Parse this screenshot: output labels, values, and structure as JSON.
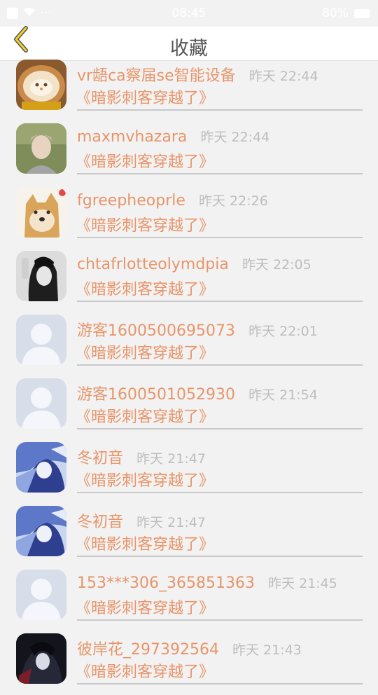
{
  "status_bar": {
    "time": "08:45",
    "battery": "80%",
    "signal": "···"
  },
  "header": {
    "title": "收藏"
  },
  "items": [
    {
      "name": "vr龉ca察届se智能设备",
      "time": "昨天 22:44",
      "game": "《暗影刺客穿越了》",
      "avatar": "latte-art-avatar"
    },
    {
      "name": "maxmvhazara",
      "time": "昨天 22:44",
      "game": "《暗影刺客穿越了》",
      "avatar": "photo-avatar-green"
    },
    {
      "name": "fgreepheoprle",
      "time": "昨天 22:26",
      "game": "《暗影刺客穿越了》",
      "avatar": "doge-avatar"
    },
    {
      "name": "chtafrlotteolymdpia",
      "time": "昨天 22:05",
      "game": "《暗影刺客穿越了》",
      "avatar": "photo-avatar-bw"
    },
    {
      "name": "游客1600500695073",
      "time": "昨天 22:01",
      "game": "《暗影刺客穿越了》",
      "avatar": "default-user-avatar"
    },
    {
      "name": "游客1600501052930",
      "time": "昨天 21:54",
      "game": "《暗影刺客穿越了》",
      "avatar": "default-user-avatar"
    },
    {
      "name": "冬初音",
      "time": "昨天 21:47",
      "game": "《暗影刺客穿越了》",
      "avatar": "anime-avatar"
    },
    {
      "name": "冬初音",
      "time": "昨天 21:47",
      "game": "《暗影刺客穿越了》",
      "avatar": "anime-avatar"
    },
    {
      "name": "153***306_365851363",
      "time": "昨天 21:45",
      "game": "《暗影刺客穿越了》",
      "avatar": "default-user-avatar"
    },
    {
      "name": "彼岸花_297392564",
      "time": "昨天 21:43",
      "game": "《暗影刺客穿越了》",
      "avatar": "dark-anime-avatar"
    }
  ],
  "colors": {
    "accent": "#e8956a",
    "muted": "#bdbdbd",
    "back_arrow": "#e8c22a"
  }
}
